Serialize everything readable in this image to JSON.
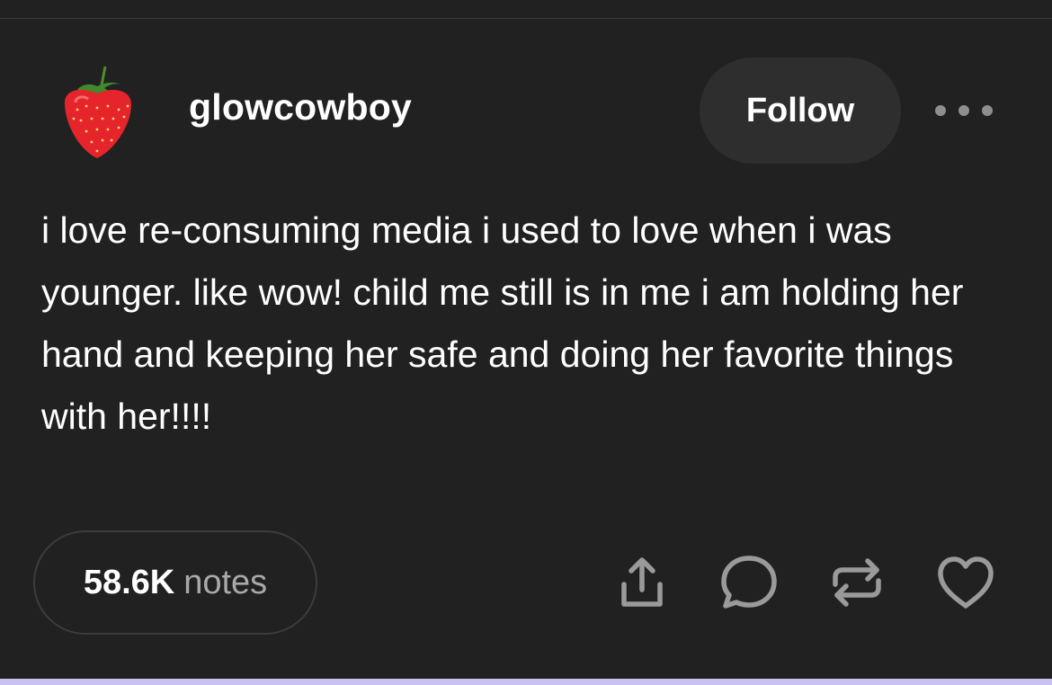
{
  "post": {
    "author": {
      "username": "glowcowboy",
      "avatar_icon": "strawberry-icon"
    },
    "header": {
      "follow_label": "Follow",
      "more_icon": "more-dots-icon"
    },
    "body_text": "i love re-consuming media i used to love when i was younger. like wow! child me still is in me i am holding her hand and keeping her safe and doing her favorite things with her!!!!",
    "footer": {
      "notes_count": "58.6K",
      "notes_label": "notes",
      "actions": [
        {
          "name": "share",
          "icon": "share-icon"
        },
        {
          "name": "reply",
          "icon": "reply-bubble-icon"
        },
        {
          "name": "reblog",
          "icon": "reblog-icon"
        },
        {
          "name": "like",
          "icon": "heart-icon"
        }
      ]
    }
  },
  "colors": {
    "background": "#212121",
    "text": "#ffffff",
    "muted_text": "#a9a9a9",
    "follow_button_bg": "#2e2e2e",
    "icon": "#9a9a9a",
    "bottom_accent": "#c9c2ee"
  }
}
